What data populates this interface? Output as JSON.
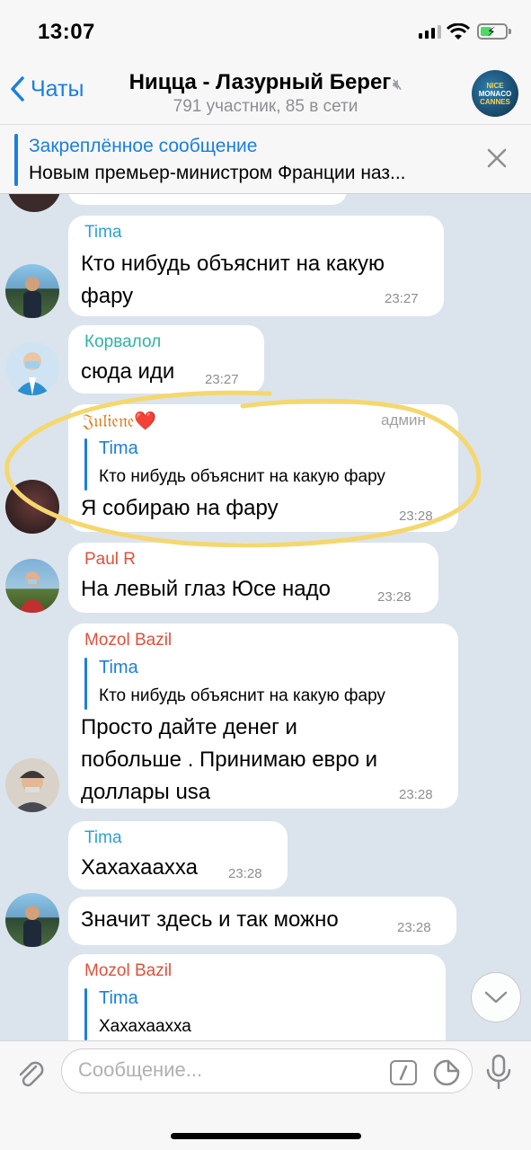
{
  "status_bar": {
    "time": "13:07"
  },
  "header": {
    "back_label": "Чаты",
    "title": "Ницца - Лазурный Берег",
    "subtitle": "791 участник, 85 в сети",
    "avatar_lines": [
      "NICE",
      "MONACO",
      "CANNES"
    ]
  },
  "pinned": {
    "title": "Закреплённое сообщение",
    "text": "Новым премьер-министром Франции наз..."
  },
  "messages": [
    {
      "sender": "Tima",
      "sender_color": "#2f9fd8",
      "text_lines": [
        "Кто нибудь объяснит на какую",
        "фару"
      ],
      "time": "23:27"
    },
    {
      "sender": "Корвалол",
      "sender_color": "#2fb3a0",
      "text_lines": [
        "сюда иди"
      ],
      "time": "23:27"
    },
    {
      "sender": "𝔍𝔲𝔩𝔦𝔢𝔫𝔢❤️",
      "sender_color": "#e07a1a",
      "badge": "админ",
      "reply_name": "Tima",
      "reply_text": "Кто нибудь объяснит на какую фару",
      "text_lines": [
        "Я собираю на фару"
      ],
      "time": "23:28"
    },
    {
      "sender": "Paul R",
      "sender_color": "#e0503a",
      "text_lines": [
        "На левый глаз Юсе надо"
      ],
      "time": "23:28"
    },
    {
      "sender": "Mozol Bazil",
      "sender_color": "#e0503a",
      "reply_name": "Tima",
      "reply_text": "Кто нибудь объяснит на какую фару",
      "text_lines": [
        "Просто дайте денег и",
        "побольше . Принимаю евро и",
        "доллары usa"
      ],
      "time": "23:28"
    },
    {
      "sender": "Tima",
      "sender_color": "#2f9fd8",
      "text_lines": [
        "Хахахаахха"
      ],
      "time": "23:28"
    },
    {
      "text_lines": [
        "Значит здесь и так можно"
      ],
      "time": "23:28"
    },
    {
      "sender": "Mozol Bazil",
      "sender_color": "#e0503a",
      "reply_name": "Tima",
      "reply_text": "Хахахаахха"
    }
  ],
  "input": {
    "placeholder": "Сообщение..."
  },
  "colors": {
    "accent": "#1a7fe0",
    "highlight": "#f5d76e",
    "chat_bg": "#dbe4ec"
  }
}
